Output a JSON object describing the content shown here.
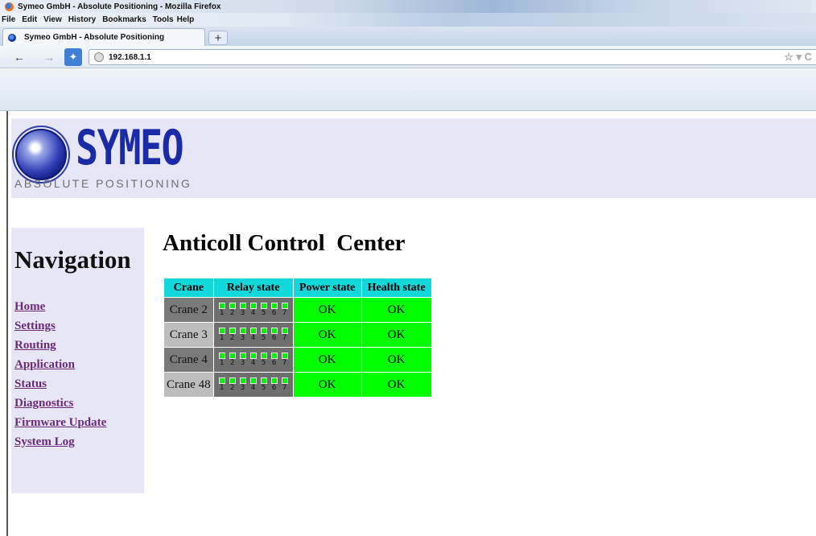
{
  "browser": {
    "window_title": "Symeo GmbH - Absolute Positioning - Mozilla Firefox",
    "menu": [
      "File",
      "Edit",
      "View",
      "History",
      "Bookmarks",
      "Tools",
      "Help"
    ],
    "tab_title": "Symeo GmbH - Absolute Positioning",
    "new_tab": "+",
    "url": "192.168.1.1",
    "icons": [
      "back-icon",
      "forward-icon",
      "home-icon",
      "globe-icon",
      "bookmark-star-icon"
    ]
  },
  "header": {
    "logo_word": "SYMEO",
    "tagline": "ABSOLUTE POSITIONING"
  },
  "navigation": {
    "heading": "Navigation",
    "links": [
      "Home",
      "Settings",
      "Routing",
      "Application",
      "Status",
      "Diagnostics",
      "Firmware Update",
      "System Log"
    ]
  },
  "main": {
    "title": "Anticoll Control  Center",
    "table": {
      "headers": [
        "Crane",
        "Relay state",
        "Power state",
        "Health state"
      ],
      "relay_numbers": [
        "1",
        "2",
        "3",
        "4",
        "5",
        "6",
        "7"
      ],
      "rows": [
        {
          "crane": "Crane 2",
          "power": "OK",
          "health": "OK"
        },
        {
          "crane": "Crane 3",
          "power": "OK",
          "health": "OK"
        },
        {
          "crane": "Crane 4",
          "power": "OK",
          "health": "OK"
        },
        {
          "crane": "Crane 48",
          "power": "OK",
          "health": "OK"
        }
      ]
    }
  },
  "colors": {
    "header_cyan": "#12d8dc",
    "ok_green": "#00ff00",
    "link_purple": "#6a2a7a",
    "panel_lavender": "#e6e6f6",
    "logo_blue": "#1b2aa6"
  }
}
